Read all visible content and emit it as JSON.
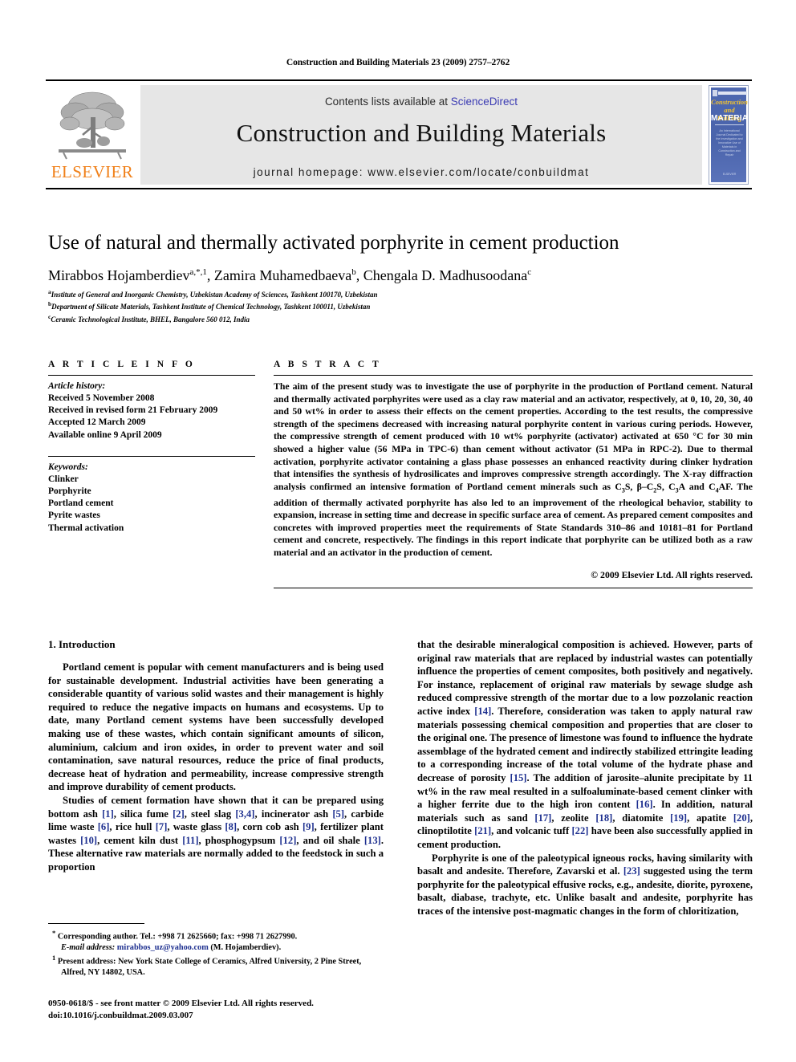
{
  "running_head": "Construction and Building Materials 23 (2009) 2757–2762",
  "masthead": {
    "contents_prefix": "Contents lists available at ",
    "sciencedirect": "ScienceDirect",
    "journal_title": "Construction and Building Materials",
    "journal_homepage": "journal homepage: www.elsevier.com/locate/conbuildmat",
    "publisher_wordmark": "ELSEVIER",
    "publisher_accent_color": "#F08019",
    "link_color": "#3b3bb3",
    "banner_color": "#e6e6e6",
    "cover": {
      "line1": "Construction",
      "line2": "and Building",
      "line3": "MATERIALS",
      "blurb": "An International Journal Dedicated to the Investigation and Innovative Use of Materials in Construction and Repair",
      "footer": "ELSEVIER",
      "bg_color": "#4a63ab",
      "title_color": "#f4c430"
    }
  },
  "article": {
    "title": "Use of natural and thermally activated porphyrite in cement production",
    "authors": [
      {
        "name": "Mirabbos Hojamberdiev",
        "marks": "a,*,1"
      },
      {
        "name": "Zamira Muhamedbaeva",
        "marks": "b"
      },
      {
        "name": "Chengala D. Madhusoodana",
        "marks": "c"
      }
    ],
    "affiliations": [
      {
        "mark": "a",
        "text": "Institute of General and Inorganic Chemistry, Uzbekistan Academy of Sciences, Tashkent 100170, Uzbekistan"
      },
      {
        "mark": "b",
        "text": "Department of Silicate Materials, Tashkent Institute of Chemical Technology, Tashkent 100011, Uzbekistan"
      },
      {
        "mark": "c",
        "text": "Ceramic Technological Institute, BHEL, Bangalore 560 012, India"
      }
    ]
  },
  "article_info": {
    "section_label": "A R T I C L E   I N F O",
    "history_title": "Article history:",
    "history": [
      "Received 5 November 2008",
      "Received in revised form 21 February 2009",
      "Accepted 12 March 2009",
      "Available online 9 April 2009"
    ],
    "keywords_title": "Keywords:",
    "keywords": [
      "Clinker",
      "Porphyrite",
      "Portland cement",
      "Pyrite wastes",
      "Thermal activation"
    ]
  },
  "abstract": {
    "section_label": "A B S T R A C T",
    "paragraph_part1": "The aim of the present study was to investigate the use of porphyrite in the production of Portland cement. Natural and thermally activated porphyrites were used as a clay raw material and an activator, respectively, at 0, 10, 20, 30, 40 and 50 wt% in order to assess their effects on the cement properties. According to the test results, the compressive strength of the specimens decreased with increasing natural porphyrite content in various curing periods. However, the compressive strength of cement produced with 10 wt% porphyrite (activator) activated at 650 °C for 30 min showed a higher value (56 MPa in TPC-6) than cement without activator (51 MPa in RPC-2). Due to thermal activation, porphyrite activator containing a glass phase possesses an enhanced reactivity during clinker hydration that intensifies the synthesis of hydrosilicates and improves compressive strength accordingly. The X-ray diffraction analysis confirmed an intensive formation of Portland cement minerals such as C",
    "minerals_tail": "S, β–C",
    "minerals_tail2": "S, C",
    "minerals_tail3": "A and C",
    "minerals_tail4": "AF. ",
    "paragraph_part2": "The addition of thermally activated porphyrite has also led to an improvement of the rheological behavior, stability to expansion, increase in setting time and decrease in specific surface area of cement. As prepared cement composites and concretes with improved properties meet the requirements of State Standards 310–86 and 10181–81 for Portland cement and concrete, respectively. The findings in this report indicate that porphyrite can be utilized both as a raw material and an activator in the production of cement.",
    "copyright": "© 2009 Elsevier Ltd. All rights reserved."
  },
  "body": {
    "section_heading": "1. Introduction",
    "left_column": {
      "p1_a": "Portland cement is popular with cement manufacturers and is being used for sustainable development. Industrial activities have been generating a considerable quantity of various solid wastes and their management is highly required to reduce the negative impacts on humans and ecosystems. Up to date, many Portland cement systems have been successfully developed making use of these wastes, which contain significant amounts of silicon, aluminium, calcium and iron oxides, in order to prevent water and soil contamination, save natural resources, reduce the price of final products, decrease heat of hydration and permeability, increase compressive strength and improve durability of cement products.",
      "p2_pre": "Studies of cement formation have shown that it can be prepared using bottom ash ",
      "p2_segments": [
        {
          "ref": "[1]",
          "text": ", silica fume "
        },
        {
          "ref": "[2]",
          "text": ", steel slag "
        },
        {
          "ref": "[3,4]",
          "text": ", incinerator ash "
        },
        {
          "ref": "[5]",
          "text": ", carbide lime waste "
        },
        {
          "ref": "[6]",
          "text": ", rice hull "
        },
        {
          "ref": "[7]",
          "text": ", waste glass "
        },
        {
          "ref": "[8]",
          "text": ", corn cob ash "
        },
        {
          "ref": "[9]",
          "text": ", fertilizer plant wastes "
        },
        {
          "ref": "[10]",
          "text": ", cement kiln dust "
        },
        {
          "ref": "[11]",
          "text": ", phosphogypsum "
        },
        {
          "ref": "[12]",
          "text": ", and oil shale "
        },
        {
          "ref": "[13]",
          "text": ". These alternative raw materials are normally added to the feedstock in such a proportion"
        }
      ]
    },
    "right_column": {
      "p1_pre": "that the desirable mineralogical composition is achieved. However, parts of original raw materials that are replaced by industrial wastes can potentially influence the properties of cement composites, both positively and negatively. For instance, replacement of original raw materials by sewage sludge ash reduced compressive strength of the mortar due to a low pozzolanic reaction active index ",
      "p1_segments": [
        {
          "ref": "[14]",
          "text": ". Therefore, consideration was taken to apply natural raw materials possessing chemical composition and properties that are closer to the original one. The presence of limestone was found to influence the hydrate assemblage of the hydrated cement and indirectly stabilized ettringite leading to a corresponding increase of the total volume of the hydrate phase and decrease of porosity "
        },
        {
          "ref": "[15]",
          "text": ". The addition of jarosite–alunite precipitate by 11 wt% in the raw meal resulted in a sulfoaluminate-based cement clinker with a higher ferrite due to the high iron content "
        },
        {
          "ref": "[16]",
          "text": ". In addition, natural materials such as sand "
        },
        {
          "ref": "[17]",
          "text": ", zeolite "
        },
        {
          "ref": "[18]",
          "text": ", diatomite "
        },
        {
          "ref": "[19]",
          "text": ", apatite "
        },
        {
          "ref": "[20]",
          "text": ", clinoptilotite "
        },
        {
          "ref": "[21]",
          "text": ", and volcanic tuff "
        },
        {
          "ref": "[22]",
          "text": " have been also successfully applied in cement production."
        }
      ],
      "p2_pre": "Porphyrite is one of the paleotypical igneous rocks, having similarity with basalt and andesite. Therefore, Zavarski et al. ",
      "p2_ref": "[23]",
      "p2_post": " suggested using the term porphyrite for the paleotypical effusive rocks, e.g., andesite, diorite, pyroxene, basalt, diabase, trachyte, etc. Unlike basalt and andesite, porphyrite has traces of the intensive post-magmatic changes in the form of chloritization,"
    }
  },
  "footnotes": {
    "corresponding": "Corresponding author. Tel.: +998 71 2625660; fax: +998 71 2627990.",
    "email_label": "E-mail address:",
    "email": "mirabbos_uz@yahoo.com",
    "email_suffix": "(M. Hojamberdiev).",
    "present_address": "Present address: New York State College of Ceramics, Alfred University, 2 Pine Street, Alfred, NY 14802, USA.",
    "corresponding_mark": "*",
    "present_mark": "1"
  },
  "imprint": {
    "line1": "0950-0618/$ - see front matter © 2009 Elsevier Ltd. All rights reserved.",
    "line2": "doi:10.1016/j.conbuildmat.2009.03.007"
  }
}
